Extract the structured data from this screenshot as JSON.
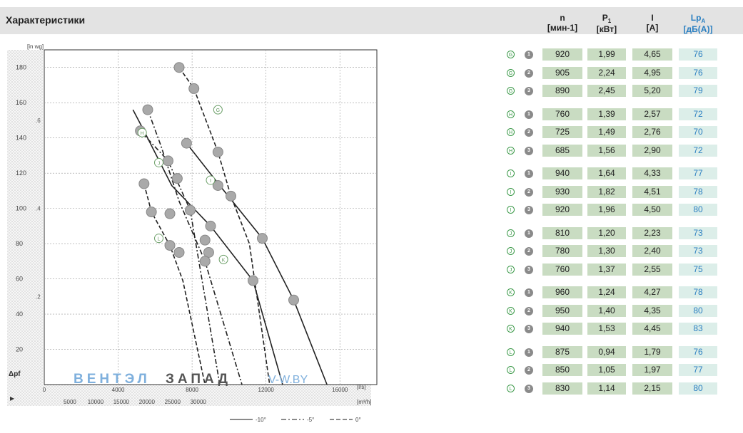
{
  "header": {
    "title": "Характеристики",
    "columns": [
      {
        "key": "n",
        "label": "n",
        "sub": "",
        "unit": "[мин-1]"
      },
      {
        "key": "p",
        "label": "P",
        "sub": "1",
        "unit": "[кВт]"
      },
      {
        "key": "i",
        "label": "I",
        "sub": "",
        "unit": "[A]"
      },
      {
        "key": "lp",
        "label": "Lp",
        "sub": "A",
        "unit": "[дБ(A)]"
      }
    ]
  },
  "rows": [
    {
      "curve": "G",
      "mode": "1",
      "n": "920",
      "p": "1,99",
      "i": "4,65",
      "lp": "76"
    },
    {
      "curve": "G",
      "mode": "2",
      "n": "905",
      "p": "2,24",
      "i": "4,95",
      "lp": "76"
    },
    {
      "curve": "G",
      "mode": "3",
      "n": "890",
      "p": "2,45",
      "i": "5,20",
      "lp": "79"
    },
    {
      "curve": "H",
      "mode": "1",
      "n": "760",
      "p": "1,39",
      "i": "2,57",
      "lp": "72"
    },
    {
      "curve": "H",
      "mode": "2",
      "n": "725",
      "p": "1,49",
      "i": "2,76",
      "lp": "70"
    },
    {
      "curve": "H",
      "mode": "3",
      "n": "685",
      "p": "1,56",
      "i": "2,90",
      "lp": "72"
    },
    {
      "curve": "I",
      "mode": "1",
      "n": "940",
      "p": "1,64",
      "i": "4,33",
      "lp": "77"
    },
    {
      "curve": "I",
      "mode": "2",
      "n": "930",
      "p": "1,82",
      "i": "4,51",
      "lp": "78"
    },
    {
      "curve": "I",
      "mode": "3",
      "n": "920",
      "p": "1,96",
      "i": "4,50",
      "lp": "80"
    },
    {
      "curve": "J",
      "mode": "1",
      "n": "810",
      "p": "1,20",
      "i": "2,23",
      "lp": "73"
    },
    {
      "curve": "J",
      "mode": "2",
      "n": "780",
      "p": "1,30",
      "i": "2,40",
      "lp": "73"
    },
    {
      "curve": "J",
      "mode": "3",
      "n": "760",
      "p": "1,37",
      "i": "2,55",
      "lp": "75"
    },
    {
      "curve": "K",
      "mode": "1",
      "n": "960",
      "p": "1,24",
      "i": "4,27",
      "lp": "78"
    },
    {
      "curve": "K",
      "mode": "2",
      "n": "950",
      "p": "1,40",
      "i": "4,35",
      "lp": "80"
    },
    {
      "curve": "K",
      "mode": "3",
      "n": "940",
      "p": "1,53",
      "i": "4,45",
      "lp": "83"
    },
    {
      "curve": "L",
      "mode": "1",
      "n": "875",
      "p": "0,94",
      "i": "1,79",
      "lp": "76"
    },
    {
      "curve": "L",
      "mode": "2",
      "n": "850",
      "p": "1,05",
      "i": "1,97",
      "lp": "77"
    },
    {
      "curve": "L",
      "mode": "3",
      "n": "830",
      "p": "1,14",
      "i": "2,15",
      "lp": "80"
    }
  ],
  "watermark": {
    "part1": "ВЕНТЭЛ",
    "part2": "ЗАПАД",
    "site": "V-W.BY"
  },
  "colors": {
    "row_bg": "#c9dcc2",
    "lp_bg": "#dceee9",
    "lp_text": "#2a7fc1",
    "curve_icon": "#3d9a4a",
    "mode_icon": "#8a8a8a"
  },
  "chart_data": {
    "type": "line",
    "title": "",
    "x_unit_primary": "[l/s]",
    "x_unit_secondary": "[m³/h]",
    "y_unit_primary": "[in wg]",
    "y_axis_icon_label": "Δpf",
    "y_ticks_pa": [
      "20",
      "40",
      "60",
      "80",
      "100",
      "120",
      "140",
      "160",
      "180"
    ],
    "y_ticks_inwg": [
      ".2",
      ".4",
      ".6"
    ],
    "x_ticks_ls": [
      "0",
      "4000",
      "8000",
      "12000",
      "16000"
    ],
    "x_ticks_m3h": [
      "5000",
      "10000",
      "15000",
      "20000",
      "25000",
      "30000"
    ],
    "xlim": [
      0,
      18000
    ],
    "ylim": [
      0,
      190
    ],
    "grid": true,
    "legend": [
      {
        "style": "solid",
        "label": "-10°"
      },
      {
        "style": "dashdot",
        "label": "-5°"
      },
      {
        "style": "dashed",
        "label": "0°"
      }
    ],
    "series": [
      {
        "name": "G",
        "style": "solid",
        "points": [
          [
            7700,
            137
          ],
          [
            9500,
            113
          ],
          [
            11800,
            83
          ],
          [
            13500,
            48
          ],
          [
            15300,
            0
          ]
        ]
      },
      {
        "name": "H",
        "style": "dashdot",
        "points": [
          [
            5200,
            144
          ],
          [
            6700,
            127
          ],
          [
            7900,
            99
          ],
          [
            9500,
            0
          ]
        ]
      },
      {
        "name": "I",
        "style": "dashed",
        "points": [
          [
            7300,
            180
          ],
          [
            8100,
            168
          ],
          [
            9400,
            132
          ],
          [
            10100,
            107
          ],
          [
            11100,
            80
          ],
          [
            12200,
            0
          ]
        ]
      },
      {
        "name": "J",
        "style": "dashdot",
        "points": [
          [
            5600,
            156
          ],
          [
            6300,
            136
          ],
          [
            7300,
            104
          ],
          [
            8700,
            70
          ],
          [
            10700,
            0
          ]
        ]
      },
      {
        "name": "K",
        "style": "solid",
        "points": [
          [
            4800,
            156
          ],
          [
            5300,
            146
          ],
          [
            6900,
            113
          ],
          [
            9000,
            90
          ],
          [
            11300,
            59
          ],
          [
            12900,
            0
          ]
        ]
      },
      {
        "name": "L",
        "style": "dashed",
        "points": [
          [
            5400,
            114
          ],
          [
            5800,
            98
          ],
          [
            6800,
            79
          ],
          [
            7500,
            59
          ],
          [
            8700,
            0
          ]
        ]
      }
    ],
    "curve_labels": [
      {
        "name": "G",
        "x": 9400,
        "y": 156
      },
      {
        "name": "H",
        "x": 5300,
        "y": 143
      },
      {
        "name": "I",
        "x": 9000,
        "y": 116
      },
      {
        "name": "J",
        "x": 6200,
        "y": 126
      },
      {
        "name": "K",
        "x": 9700,
        "y": 71
      },
      {
        "name": "L",
        "x": 6200,
        "y": 83
      }
    ],
    "markers": [
      {
        "x": 5200,
        "y": 144
      },
      {
        "x": 5600,
        "y": 156
      },
      {
        "x": 6700,
        "y": 127
      },
      {
        "x": 7200,
        "y": 117
      },
      {
        "x": 5400,
        "y": 114
      },
      {
        "x": 5800,
        "y": 98
      },
      {
        "x": 6800,
        "y": 97
      },
      {
        "x": 7300,
        "y": 180
      },
      {
        "x": 7700,
        "y": 137
      },
      {
        "x": 7900,
        "y": 99
      },
      {
        "x": 8100,
        "y": 168
      },
      {
        "x": 8700,
        "y": 82
      },
      {
        "x": 8900,
        "y": 75
      },
      {
        "x": 9000,
        "y": 90
      },
      {
        "x": 9400,
        "y": 132
      },
      {
        "x": 9400,
        "y": 113
      },
      {
        "x": 10100,
        "y": 107
      },
      {
        "x": 11300,
        "y": 59
      },
      {
        "x": 11800,
        "y": 83
      },
      {
        "x": 13500,
        "y": 48
      },
      {
        "x": 6800,
        "y": 79
      },
      {
        "x": 7300,
        "y": 75
      },
      {
        "x": 8700,
        "y": 70
      }
    ]
  }
}
